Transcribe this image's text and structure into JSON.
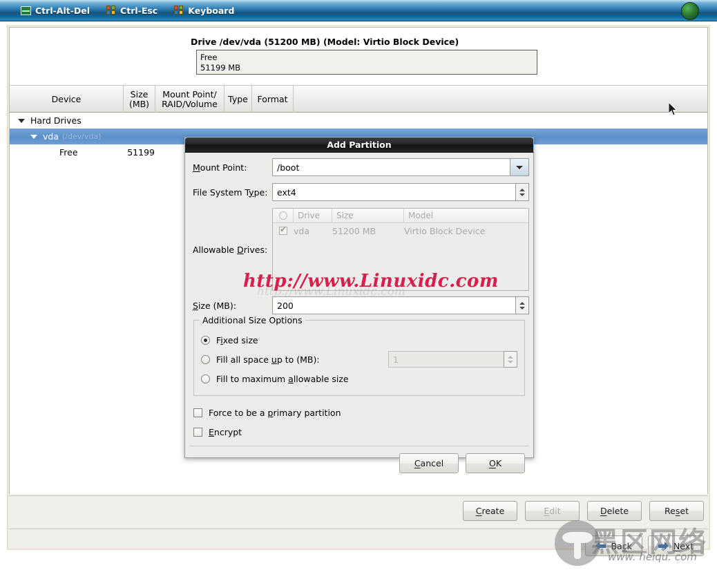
{
  "vnc_toolbar": {
    "items": [
      {
        "label": "Ctrl-Alt-Del",
        "icon": "monitor-icon"
      },
      {
        "label": "Ctrl-Esc",
        "icon": "windows-flag-icon"
      },
      {
        "label": "Keyboard",
        "icon": "windows-flag-icon"
      }
    ],
    "status_badge": "green-orb-icon"
  },
  "drive_summary": {
    "title": "Drive /dev/vda (51200 MB) (Model: Virtio Block Device)",
    "segment_label": "Free",
    "segment_size": "51199 MB"
  },
  "device_table": {
    "columns": [
      "Device",
      "Size\n(MB)",
      "Mount Point/\nRAID/Volume",
      "Type",
      "Format"
    ],
    "col_device": "Device",
    "col_size_l1": "Size",
    "col_size_l2": "(MB)",
    "col_mount_l1": "Mount Point/",
    "col_mount_l2": "RAID/Volume",
    "col_type": "Type",
    "col_format": "Format",
    "rows": [
      {
        "label": "Hard Drives",
        "sub": "",
        "size": "",
        "indent": 0,
        "expander": true,
        "selected": false
      },
      {
        "label": "vda",
        "sub": "(/dev/vda)",
        "size": "",
        "indent": 1,
        "expander": true,
        "selected": true
      },
      {
        "label": "Free",
        "sub": "",
        "size": "51199",
        "indent": 2,
        "expander": false,
        "selected": false
      }
    ]
  },
  "action_buttons": [
    {
      "label": "Create",
      "accel": "C",
      "disabled": false
    },
    {
      "label": "Edit",
      "accel": "E",
      "disabled": true
    },
    {
      "label": "Delete",
      "accel": "D",
      "disabled": false
    },
    {
      "label": "Reset",
      "accel": "s",
      "disabled": false
    }
  ],
  "nav_buttons": [
    {
      "label": "Back",
      "accel": "B",
      "icon": "arrow-left-icon"
    },
    {
      "label": "Next",
      "accel": "N",
      "icon": "arrow-right-icon"
    }
  ],
  "dialog": {
    "title": "Add Partition",
    "mount_point": {
      "label": "Mount Point:",
      "accel_prefix": "M",
      "accel_rest": "ount Point:",
      "value": "/boot",
      "icon": "chevron-down-icon"
    },
    "fs_type": {
      "label_a": "File System T",
      "label_accel": "y",
      "label_b": "pe:",
      "value": "ext4",
      "icon": "spinner-updown-icon"
    },
    "allowable_drives": {
      "label_a": "Allowable ",
      "label_accel": "D",
      "label_b": "rives:",
      "columns": [
        "",
        "Drive",
        "Size",
        "Model"
      ],
      "col_drive": "Drive",
      "col_size": "Size",
      "col_model": "Model",
      "rows": [
        {
          "checked": true,
          "drive": "vda",
          "size": "51200 MB",
          "model": "Virtio Block Device"
        }
      ]
    },
    "size": {
      "label_accel": "S",
      "label_rest": "ize (MB):",
      "value": "200",
      "icon": "spinner-updown-icon"
    },
    "additional_size_options": {
      "legend": "Additional Size Options",
      "options": [
        {
          "label_a": "F",
          "label_accel": "i",
          "label_b": "xed size",
          "selected": true,
          "disabled": false
        },
        {
          "label_a": "Fill all space ",
          "label_accel": "u",
          "label_b": "p to (MB):",
          "selected": false,
          "disabled": false,
          "field_value": "1",
          "field_disabled": true
        },
        {
          "label_a": "Fill to maximum ",
          "label_accel": "a",
          "label_b": "llowable size",
          "selected": false,
          "disabled": false
        }
      ]
    },
    "checkboxes": [
      {
        "label_a": "Force to be a ",
        "label_accel": "p",
        "label_b": "rimary partition",
        "checked": false
      },
      {
        "label_a": "",
        "label_accel": "E",
        "label_b": "ncrypt",
        "checked": false
      }
    ],
    "buttons": [
      {
        "label_a": "",
        "label_accel": "C",
        "label_b": "ancel",
        "name": "cancel"
      },
      {
        "label_a": "",
        "label_accel": "O",
        "label_b": "K",
        "name": "ok"
      }
    ]
  },
  "watermarks": {
    "red_url": "http://www.Linuxidc.com",
    "ghost_url": "http://www.Linuxidc.com",
    "cn_text": "黑区网络",
    "site_url": "www. heiqu. com"
  },
  "colors": {
    "toolbar_blue": "#14547f",
    "selection_blue": "#5b8fc9",
    "watermark_red": "#d61f4a",
    "panel_bg": "#f0efeb",
    "dialog_bg": "#edecea"
  }
}
